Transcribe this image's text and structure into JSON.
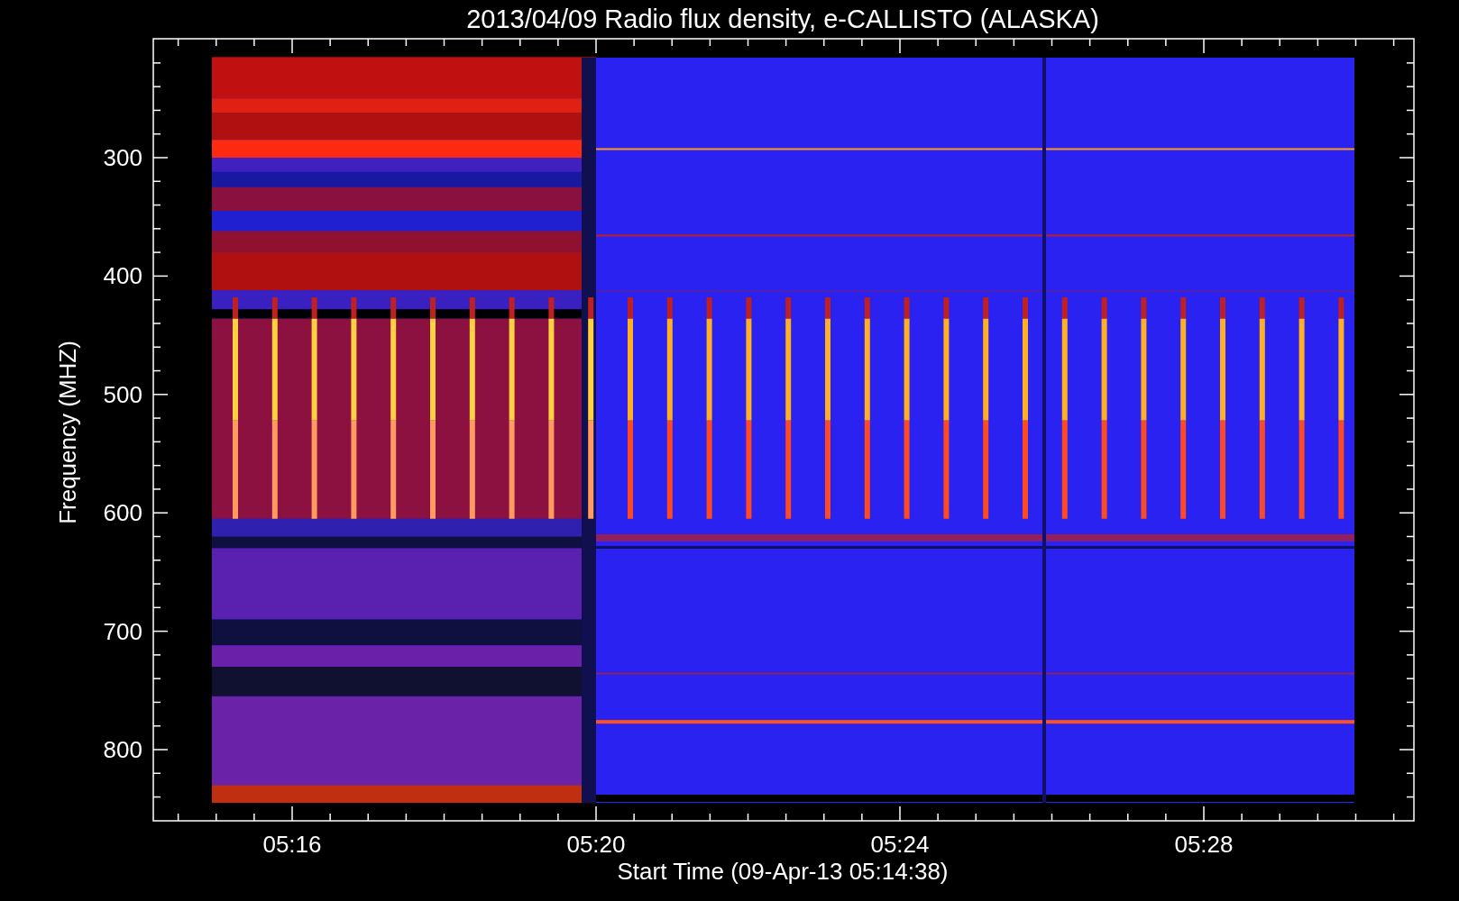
{
  "plot": {
    "title": "2013/04/09  Radio flux density, e-CALLISTO (ALASKA)",
    "ylabel": "Frequency (MHZ)",
    "xlabel": "Start Time (09-Apr-13 05:14:38)",
    "yticks": [
      "300",
      "400",
      "500",
      "600",
      "700",
      "800"
    ],
    "xticks": [
      "05:16",
      "05:20",
      "05:24",
      "05:28"
    ]
  }
}
